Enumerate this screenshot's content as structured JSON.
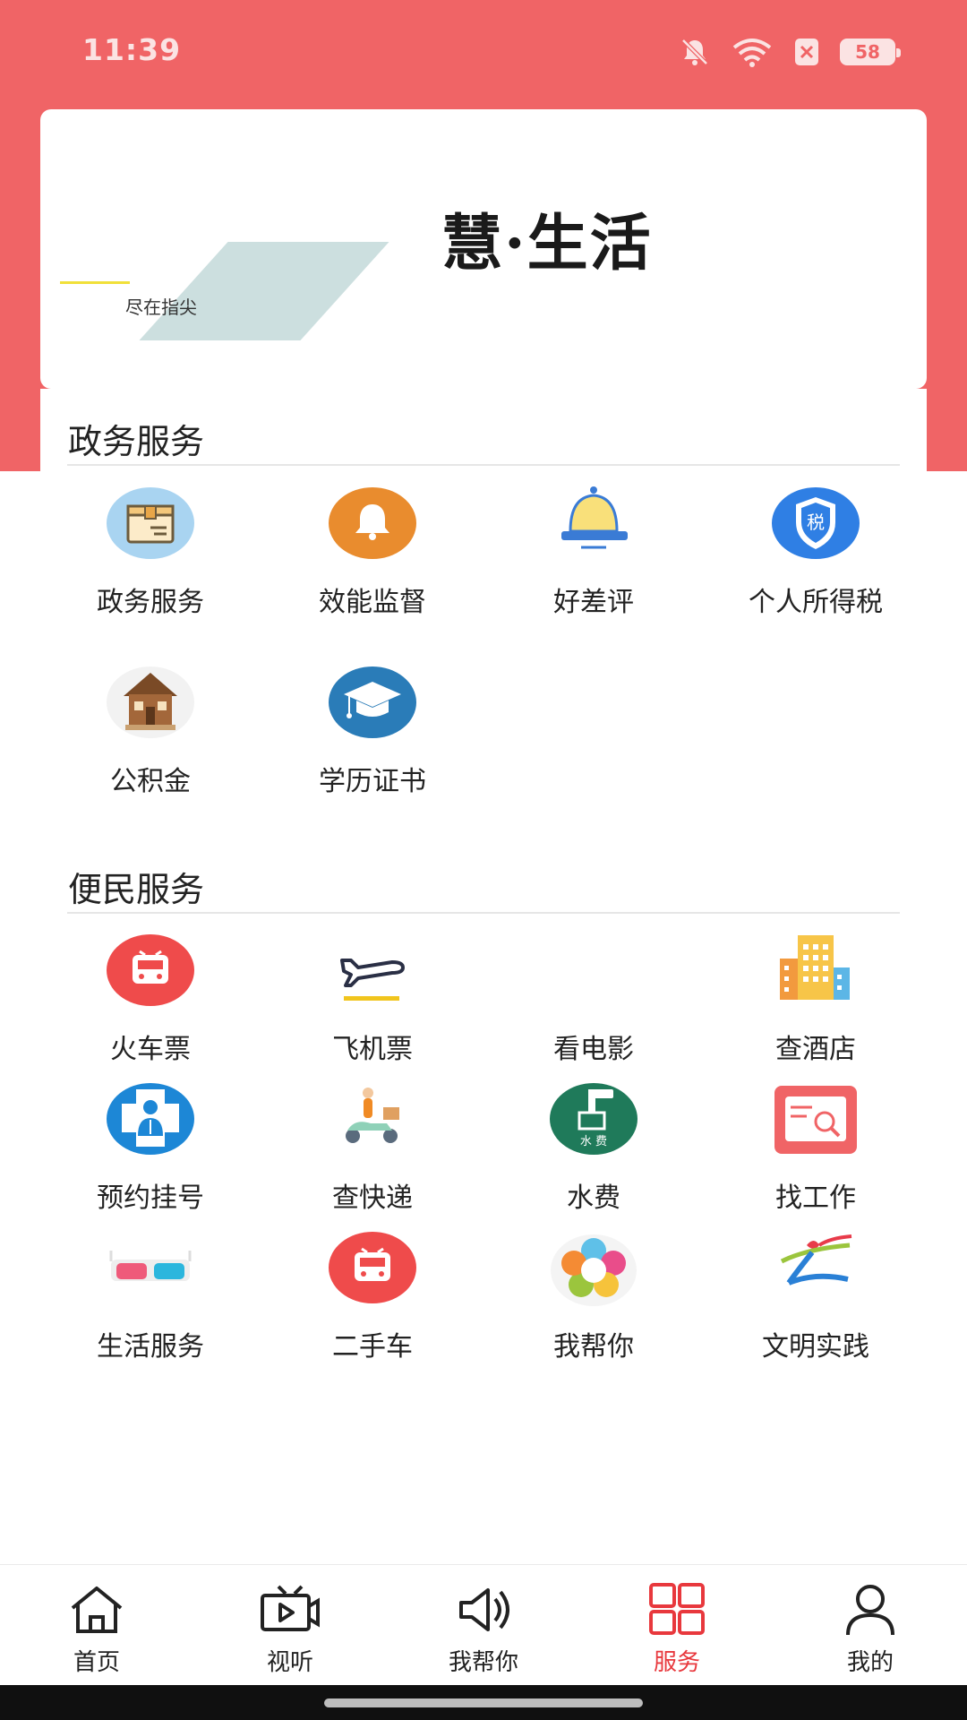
{
  "status_bar": {
    "time": "11:39",
    "battery": "58",
    "icons": [
      "bell-off-icon",
      "wifi-icon",
      "sim-off-icon",
      "battery-icon"
    ]
  },
  "banner": {
    "title": "慧·生活",
    "subtitle": "尽在指尖"
  },
  "sections": [
    {
      "title": "政务服务",
      "items": [
        {
          "label": "政务服务",
          "icon": "parcel-box-icon"
        },
        {
          "label": "效能监督",
          "icon": "bell-icon"
        },
        {
          "label": "好差评",
          "icon": "desk-bell-icon"
        },
        {
          "label": "个人所得税",
          "icon": "tax-shield-icon"
        },
        {
          "label": "公积金",
          "icon": "house-icon"
        },
        {
          "label": "学历证书",
          "icon": "graduation-cap-icon"
        }
      ]
    },
    {
      "title": "便民服务",
      "items": [
        {
          "label": "火车票",
          "icon": "train-icon"
        },
        {
          "label": "飞机票",
          "icon": "airplane-icon"
        },
        {
          "label": "看电影",
          "icon": ""
        },
        {
          "label": "查酒店",
          "icon": "hotel-icon"
        },
        {
          "label": "预约挂号",
          "icon": "doctor-icon"
        },
        {
          "label": "查快递",
          "icon": "delivery-scooter-icon"
        },
        {
          "label": "水费",
          "icon": "water-fee-icon",
          "badge": "水 费"
        },
        {
          "label": "找工作",
          "icon": "job-search-icon"
        },
        {
          "label": "生活服务",
          "icon": "3d-glasses-icon"
        },
        {
          "label": "二手车",
          "icon": "used-car-icon"
        },
        {
          "label": "我帮你",
          "icon": "colorful-flower-icon"
        },
        {
          "label": "文明实践",
          "icon": "civilization-logo-icon"
        }
      ]
    }
  ],
  "tabbar": {
    "items": [
      {
        "label": "首页",
        "icon": "home-icon",
        "active": false
      },
      {
        "label": "视听",
        "icon": "tv-play-icon",
        "active": false
      },
      {
        "label": "我帮你",
        "icon": "speaker-icon",
        "active": false
      },
      {
        "label": "服务",
        "icon": "grid-icon",
        "active": true
      },
      {
        "label": "我的",
        "icon": "user-icon",
        "active": false
      }
    ]
  },
  "colors": {
    "header_red": "#f06466",
    "active_tab": "#e8383d",
    "text": "#222222"
  }
}
